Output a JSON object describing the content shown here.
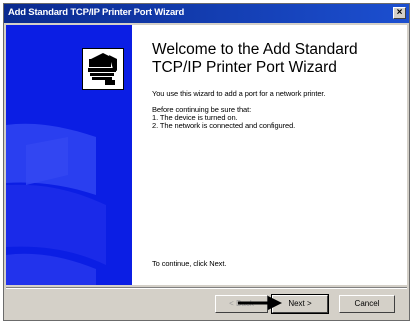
{
  "window": {
    "title": "Add Standard TCP/IP Printer Port Wizard",
    "close_glyph": "×"
  },
  "welcome": {
    "title": "Welcome to the Add Standard TCP/IP Printer Port Wizard",
    "intro": "You use this wizard to add a port for a network printer.",
    "before_heading": "Before continuing be sure that:",
    "requirements": [
      "1.  The device is turned on.",
      "2.  The network is connected and configured."
    ],
    "continue_text": "To continue, click Next."
  },
  "buttons": {
    "back_label": "< Back",
    "next_label": "Next >",
    "cancel_label": "Cancel"
  },
  "colors": {
    "titlebar": "#0a2a8f",
    "side_panel": "#0b1ee4",
    "dialog_face": "#d4d0c8"
  },
  "icons": [
    "close-icon",
    "printer-icon",
    "pointer-arrow-icon"
  ]
}
